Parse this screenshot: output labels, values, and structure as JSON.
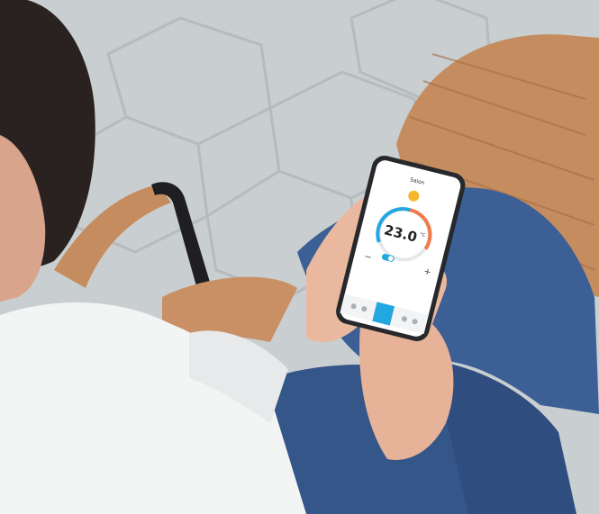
{
  "scene": {
    "description_free_note": "",
    "colors": {
      "pavement": "#c9ced0",
      "pavement_dark": "#b4babc",
      "wicker": "#c58d5f",
      "wicker_dark": "#a26b44",
      "jeans": "#3c5f95",
      "jeans_dark": "#2b4674",
      "shirt": "#f3f4f4",
      "skin": "#e9b89f",
      "hair": "#2a2220",
      "phone_body": "#26282c",
      "screen": "#ffffff",
      "accent": "#22a7e0",
      "warm_arc": "#f07a4b",
      "sun": "#f5b82a"
    }
  },
  "phone": {
    "title": "Salon",
    "temperature": "23.0",
    "unit": "°C",
    "minus": "−",
    "plus": "+"
  }
}
